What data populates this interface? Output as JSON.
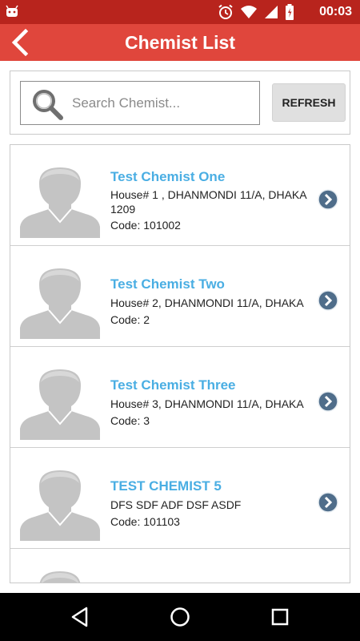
{
  "status_bar": {
    "time": "00:03",
    "icons": [
      "android-icon",
      "alarm-icon",
      "wifi-icon",
      "signal-icon",
      "battery-icon"
    ]
  },
  "app_bar": {
    "title": "Chemist List",
    "back_icon": "chevron-left-icon"
  },
  "search": {
    "placeholder": "Search Chemist...",
    "value": "",
    "refresh_label": "REFRESH"
  },
  "chemists": [
    {
      "name": "Test Chemist One",
      "address": "House# 1 , DHANMONDI 11/A, DHAKA 1209",
      "code": "Code: 101002"
    },
    {
      "name": "Test Chemist Two",
      "address": "House# 2, DHANMONDI 11/A, DHAKA",
      "code": "Code: 2"
    },
    {
      "name": "Test Chemist Three",
      "address": "House# 3, DHANMONDI 11/A, DHAKA",
      "code": "Code: 3"
    },
    {
      "name": "TEST CHEMIST 5",
      "address": "DFS SDF ADF DSF ASDF",
      "code": "Code: 101103"
    }
  ],
  "nav_bar": {
    "icons": [
      "back-triangle-icon",
      "home-circle-icon",
      "recents-square-icon"
    ]
  },
  "colors": {
    "status_bar": "#b8241d",
    "app_bar": "#e0463c",
    "name_text": "#4aaee3",
    "arrow_fill": "#4f6d8a"
  }
}
